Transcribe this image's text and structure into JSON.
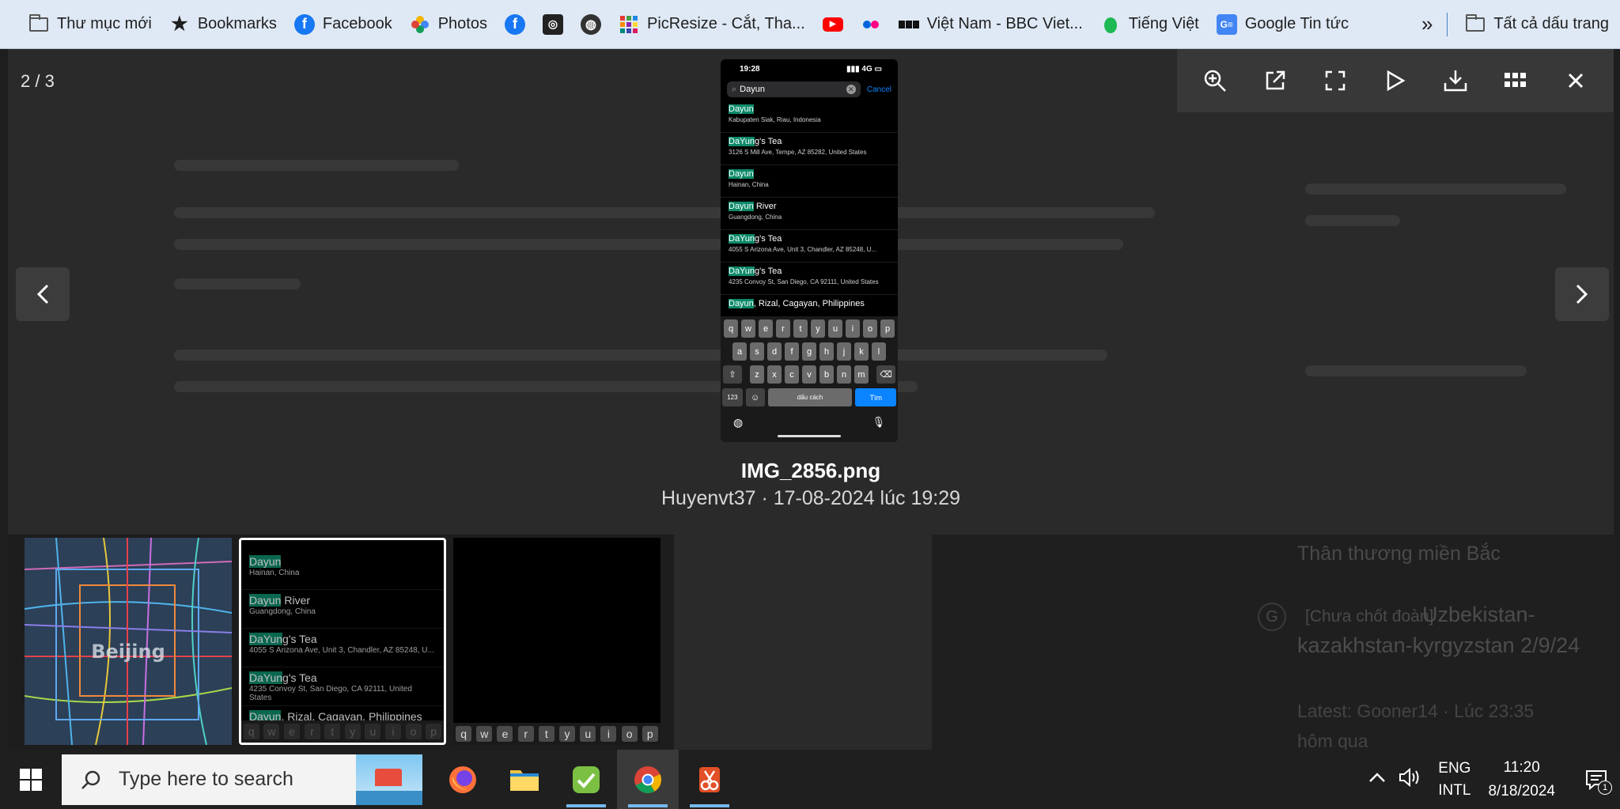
{
  "bookmarks": {
    "items": [
      {
        "label": "Thư mục mới",
        "icon": "folder-icon"
      },
      {
        "label": "Bookmarks",
        "icon": "star-icon"
      },
      {
        "label": "Facebook",
        "icon": "facebook-icon"
      },
      {
        "label": "Photos",
        "icon": "photos-icon"
      },
      {
        "label": "PicResize - Cắt, Tha...",
        "icon": "picresize-icon"
      },
      {
        "label": "Việt Nam - BBC Viet...",
        "icon": "bbc-icon"
      },
      {
        "label": "Tiếng Việt",
        "icon": "leaf-icon"
      },
      {
        "label": "Google Tin tức",
        "icon": "google-news-icon"
      }
    ],
    "overflow_label": "»",
    "all_bookmarks_label": "Tất cả dấu trang"
  },
  "viewer": {
    "counter": "2 / 3",
    "filename": "IMG_2856.png",
    "info": "Huyenvt37 · 17-08-2024 lúc 19:29",
    "phone": {
      "time": "19:28",
      "network": "4G",
      "search_value": "Dayun",
      "cancel_label": "Cancel",
      "results": [
        {
          "hl": "Dayun",
          "rest": "",
          "sub": "Kabupaten Siak, Riau, Indonesia"
        },
        {
          "hl": "DaYun",
          "rest": "g's Tea",
          "sub": "3126 S Mill Ave, Tempe, AZ 85282, United States"
        },
        {
          "hl": "Dayun",
          "rest": "",
          "sub": "Hainan, China"
        },
        {
          "hl": "Dayun",
          "rest": " River",
          "sub": "Guangdong, China"
        },
        {
          "hl": "DaYun",
          "rest": "g's Tea",
          "sub": "4055 S Arizona Ave, Unit 3, Chandler, AZ 85248, U..."
        },
        {
          "hl": "DaYun",
          "rest": "g's Tea",
          "sub": "4235 Convoy St, San Diego, CA 92111, United States"
        },
        {
          "hl": "Dayun",
          "rest": ", Rizal, Cagayan, Philippines",
          "sub": ""
        }
      ],
      "keyboard": {
        "row1": [
          "q",
          "w",
          "e",
          "r",
          "t",
          "y",
          "u",
          "i",
          "o",
          "p"
        ],
        "row2": [
          "a",
          "s",
          "d",
          "f",
          "g",
          "h",
          "j",
          "k",
          "l"
        ],
        "row3": [
          "z",
          "x",
          "c",
          "v",
          "b",
          "n",
          "m"
        ],
        "num_label": "123",
        "space_label": "dấu cách",
        "go_label": "Tìm"
      }
    },
    "thumb2": {
      "results": [
        {
          "hl": "Dayun",
          "rest": "",
          "sub": "Hainan, China"
        },
        {
          "hl": "Dayun",
          "rest": " River",
          "sub": "Guangdong, China"
        },
        {
          "hl": "DaYun",
          "rest": "g's Tea",
          "sub": "4055 S Arizona Ave, Unit 3, Chandler, AZ 85248, U..."
        },
        {
          "hl": "DaYun",
          "rest": "g's Tea",
          "sub": "4235 Convoy St, San Diego, CA 92111, United States"
        },
        {
          "hl": "Dayun",
          "rest": ", Rizal, Cagayan, Philippines",
          "sub": ""
        }
      ],
      "keys": [
        "q",
        "w",
        "e",
        "r",
        "t",
        "y",
        "u",
        "i",
        "o",
        "p"
      ]
    },
    "thumb1_label": "Beijing",
    "thumb3_keys": [
      "q",
      "w",
      "e",
      "r",
      "t",
      "y",
      "u",
      "i",
      "o",
      "p"
    ]
  },
  "side": {
    "line1": "Thân thương miền Bắc",
    "badge": "[Chưa chốt đoàn]",
    "title": "Uzbekistan-kazakhstan-kyrgyzstan 2/9/24",
    "latest": "Latest: Gooner14 · Lúc 23:35 hôm qua"
  },
  "taskbar": {
    "search_placeholder": "Type here to search",
    "lang_line1": "ENG",
    "lang_line2": "INTL",
    "time": "11:20",
    "date": "8/18/2024",
    "notifications": "1"
  }
}
